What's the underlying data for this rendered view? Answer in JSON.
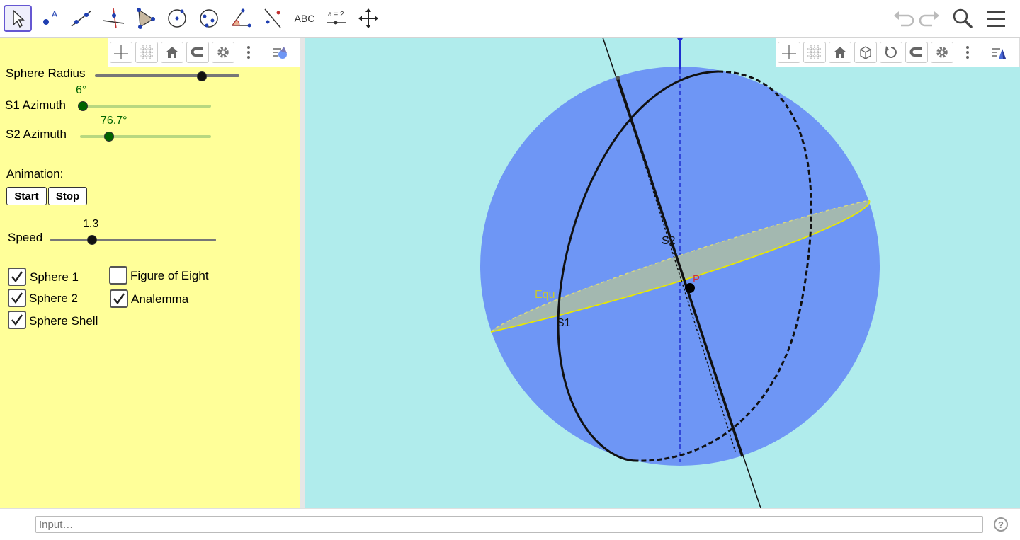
{
  "toolbar": {
    "tools": [
      {
        "name": "move-tool",
        "active": true
      },
      {
        "name": "point-tool"
      },
      {
        "name": "line-tool"
      },
      {
        "name": "perpendicular-line-tool"
      },
      {
        "name": "polygon-tool"
      },
      {
        "name": "circle-tool"
      },
      {
        "name": "ellipse-tool"
      },
      {
        "name": "angle-tool"
      },
      {
        "name": "reflect-tool"
      },
      {
        "name": "text-tool",
        "label": "ABC"
      },
      {
        "name": "slider-tool",
        "label": "a = 2"
      },
      {
        "name": "move-graphics-view-tool"
      }
    ]
  },
  "sliders": {
    "sphere_radius": {
      "label": "Sphere Radius",
      "fraction": 0.74
    },
    "s1_azimuth": {
      "label": "S1 Azimuth",
      "value": "6°",
      "fraction": 0.02
    },
    "s2_azimuth": {
      "label": "S2 Azimuth",
      "value": "76.7°",
      "fraction": 0.22
    },
    "speed": {
      "label": "Speed",
      "value": "1.3",
      "fraction": 0.25
    }
  },
  "animation": {
    "label": "Animation:",
    "start": "Start",
    "stop": "Stop"
  },
  "checkboxes": {
    "sphere1": {
      "label": "Sphere 1",
      "checked": true
    },
    "sphere2": {
      "label": "Sphere 2",
      "checked": true
    },
    "sphere_shell": {
      "label": "Sphere Shell",
      "checked": true
    },
    "figure_of_eight": {
      "label": "Figure of Eight",
      "checked": false
    },
    "analemma": {
      "label": "Analemma",
      "checked": true
    }
  },
  "graphics_labels": {
    "s1": "S1",
    "s2": "S2",
    "equ": "Equ",
    "point": "P'"
  },
  "input": {
    "placeholder": "Input…"
  },
  "help_symbol": "?",
  "colors": {
    "panel_bg": "#ffff99",
    "graphics_bg": "#b0ecec",
    "sphere": "#6e96f5",
    "equator_plane": "#a3b8b0",
    "equator_line": "#e8e800",
    "accent": "#6557d2"
  }
}
